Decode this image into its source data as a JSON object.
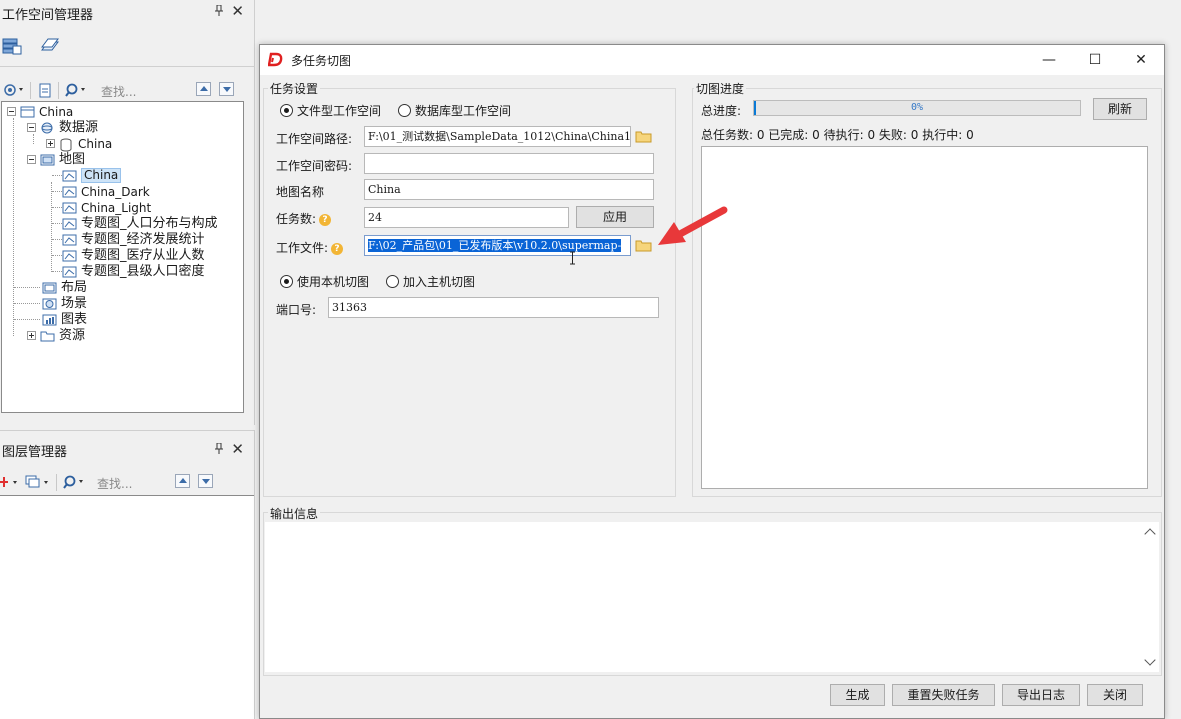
{
  "workspace_panel": {
    "title": "工作空间管理器",
    "pin": "📌",
    "close": "✕",
    "search_placeholder": "查找...",
    "tree": {
      "root": "China",
      "datasources_label": "数据源",
      "datasource_china": "China",
      "maps_label": "地图",
      "maps": [
        "China",
        "China_Dark",
        "China_Light",
        "专题图_人口分布与构成",
        "专题图_经济发展统计",
        "专题图_医疗从业人数",
        "专题图_县级人口密度"
      ],
      "layout_label": "布局",
      "scene_label": "场景",
      "chart_label": "图表",
      "resource_label": "资源"
    }
  },
  "layer_panel": {
    "title": "图层管理器",
    "close": "✕",
    "search_placeholder": "查找..."
  },
  "dialog": {
    "title": "多任务切图",
    "minimize": "—",
    "maximize": "☐",
    "close": "✕",
    "task_settings": {
      "group_label": "任务设置",
      "radio_file": "文件型工作空间",
      "radio_db": "数据库型工作空间",
      "workspace_path_label": "工作空间路径:",
      "workspace_path_value": "F:\\01_测试数据\\SampleData_1012\\China\\China1(",
      "workspace_password_label": "工作空间密码:",
      "workspace_password_value": "",
      "map_name_label": "地图名称",
      "map_name_value": "China",
      "task_count_label": "任务数:",
      "task_count_value": "24",
      "apply_button": "应用",
      "work_file_label": "工作文件:",
      "work_file_value": "F:\\02_产品包\\01_已发布版本\\v10.2.0\\supermap-",
      "radio_local": "使用本机切图",
      "radio_host": "加入主机切图",
      "port_label": "端口号:",
      "port_value": "31363"
    },
    "progress_section": {
      "group_label": "切图进度",
      "total_progress_label": "总进度:",
      "progress_percent": 0,
      "progress_text": "0%",
      "refresh_button": "刷新",
      "stats_text": "总任务数: 0 已完成: 0 待执行: 0 失败: 0 执行中: 0"
    },
    "output_section": {
      "group_label": "输出信息"
    },
    "buttons": {
      "generate": "生成",
      "reset_failed": "重置失败任务",
      "export_log": "导出日志",
      "close": "关闭"
    }
  },
  "colors": {
    "accent_arrow": "#e8383a",
    "selection": "#0a64d6",
    "progress": "#0a7ad6"
  }
}
